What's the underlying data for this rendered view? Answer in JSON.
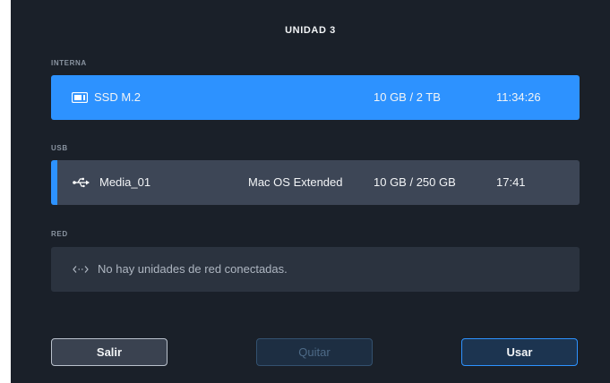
{
  "title": "UNIDAD 3",
  "colors": {
    "accent": "#2d92ff",
    "background": "#1a2029",
    "row_usb": "#3d4656",
    "row_net": "#2b333f"
  },
  "sections": {
    "internal": {
      "label": "INTERNA",
      "drive": {
        "icon": "ssd-drive-icon",
        "name": "SSD M.2",
        "usage": "10 GB / 2 TB",
        "time": "11:34:26"
      }
    },
    "usb": {
      "label": "USB",
      "drive": {
        "icon": "usb-icon",
        "name": "Media_01",
        "format": "Mac OS Extended",
        "usage": "10 GB / 250 GB",
        "time": "17:41"
      }
    },
    "network": {
      "label": "RED",
      "icon": "network-arrows-icon",
      "message": "No hay unidades de red conectadas."
    }
  },
  "buttons": {
    "exit": "Salir",
    "remove": "Quitar",
    "use": "Usar"
  }
}
